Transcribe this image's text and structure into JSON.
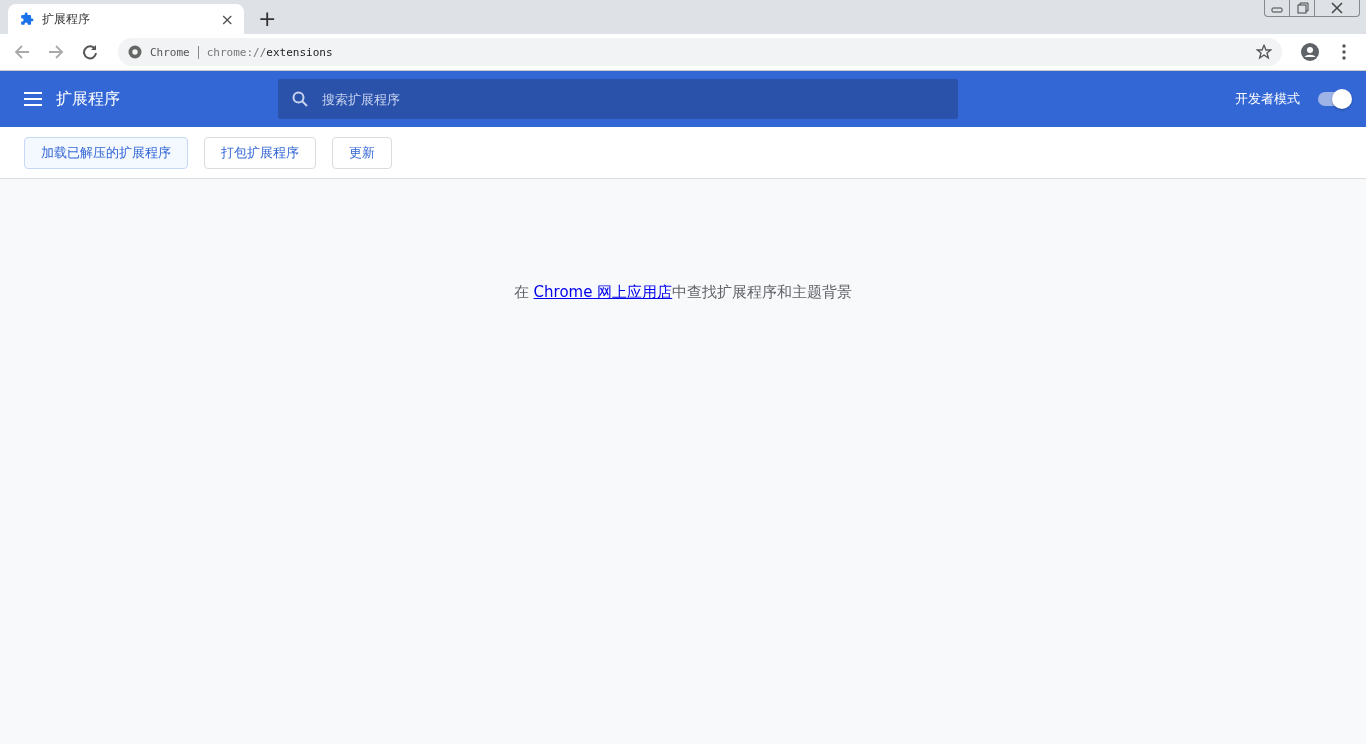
{
  "tabs": [
    {
      "title": "扩展程序",
      "selected": true,
      "close": "×"
    }
  ],
  "new_tab": "+",
  "address_bar": {
    "site_label": "Chrome",
    "url_scheme": "chrome://",
    "url_path": "extensions"
  },
  "header": {
    "title": "扩展程序",
    "search": {
      "placeholder": "搜索扩展程序"
    },
    "dev_mode": {
      "label": "开发者模式",
      "on": true
    }
  },
  "toolbar": [
    {
      "label": "加载已解压的扩展程序",
      "focused": true
    },
    {
      "label": "打包扩展程序",
      "focused": false
    },
    {
      "label": "更新",
      "focused": false
    }
  ],
  "message": {
    "before": "在 ",
    "link": "Chrome 网上应用店",
    "after": "中查找扩展程序和主题背景"
  }
}
